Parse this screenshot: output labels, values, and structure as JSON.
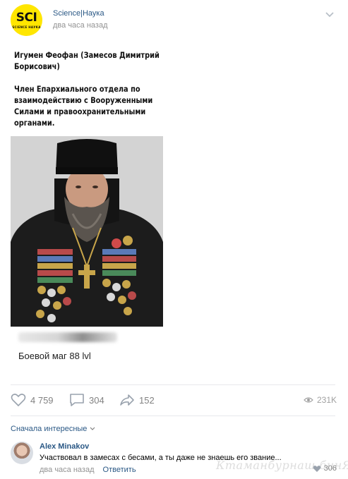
{
  "post": {
    "channel_name": "Science|Наука",
    "time": "два часа назад",
    "avatar": {
      "logo": "SCI",
      "logo_sub": "SCIENCE НАУКА"
    },
    "text": {
      "line1": "Игумен Феофан (Замесов Димитрий\nБорисович)",
      "line2": "Член Епархиального отдела по\nвзаимодействию с Вооруженными\nСилами и правоохранительными\nорганами."
    },
    "caption": "Боевой маг 88 lvl"
  },
  "actions": {
    "likes": "4 759",
    "comments": "304",
    "shares": "152",
    "views": "231K"
  },
  "comments_section": {
    "sort_label": "Сначала интересные",
    "comment": {
      "author": "Alex Minakov",
      "text": "Участвовал в замесах с бесами, а ты даже не знаешь его звание...",
      "time": "два часа назад",
      "reply_label": "Ответить",
      "likes": "306"
    }
  },
  "watermark": "Ктаманбурнаш бинЯП",
  "colors": {
    "link": "#2a5885",
    "muted": "#828282",
    "brand_yellow": "#ffe600"
  }
}
